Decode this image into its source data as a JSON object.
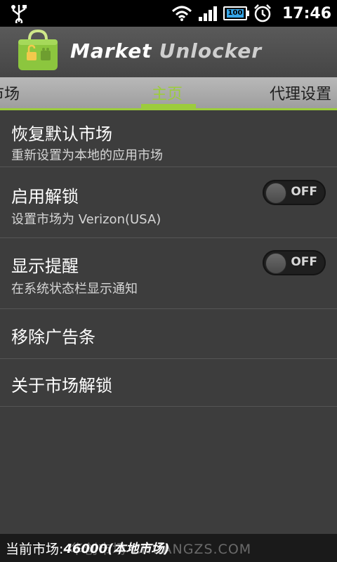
{
  "status_bar": {
    "time": "17:46",
    "battery": "100",
    "icons": [
      "usb-icon",
      "wifi-icon",
      "signal-icon",
      "battery-icon",
      "alarm-icon"
    ]
  },
  "header": {
    "title_part1": "Market",
    "title_part2": "Unlocker",
    "logo": "market-bag-lock-icon"
  },
  "tabs": {
    "left": "市场",
    "center": "主页",
    "right": "代理设置"
  },
  "items": [
    {
      "title": "恢复默认市场",
      "subtitle": "重新设置为本地的应用市场"
    },
    {
      "title": "启用解锁",
      "subtitle": "设置市场为 Verizon(USA)",
      "toggle": "OFF"
    },
    {
      "title": "显示提醒",
      "subtitle": "在系统状态栏显示通知",
      "toggle": "OFF"
    },
    {
      "title": "移除广告条"
    },
    {
      "title": "关于市场解锁"
    }
  ],
  "footer": {
    "label": "当前市场:",
    "value": "46000(本地市场)",
    "watermark": "华创市场 CHUANGZS.COM"
  },
  "colors": {
    "accent": "#9ccc3c",
    "background": "#3d3d3d",
    "status_bar": "#000000"
  }
}
